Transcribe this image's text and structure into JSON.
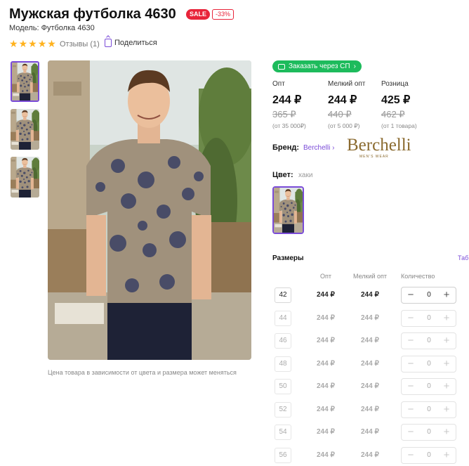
{
  "product": {
    "title": "Мужская футболка 4630",
    "sale_badge": "SALE",
    "discount_badge": "-33%",
    "model": "Модель: Футболка 4630",
    "rating": 5,
    "reviews": "Отзывы (1)",
    "share": "Поделиться",
    "price_note": "Цена товара в зависимости от цвета и размера может меняться"
  },
  "joint_purchase": {
    "label": "Заказать через СП",
    "arrow": "›"
  },
  "prices": [
    {
      "label": "Опт",
      "now": "244 ₽",
      "old": "365 ₽",
      "condition": "(от 35 000₽)"
    },
    {
      "label": "Мелкий опт",
      "now": "244 ₽",
      "old": "440 ₽",
      "condition": "(от 5 000 ₽)"
    },
    {
      "label": "Розница",
      "now": "425 ₽",
      "old": "462 ₽",
      "condition": "(от 1 товара)"
    }
  ],
  "brand": {
    "label": "Бренд:",
    "name": "Berchelli",
    "arrow": "›",
    "logo": "Berchelli",
    "logo_sub": "MEN'S WEAR"
  },
  "color": {
    "label": "Цвет:",
    "value": "хаки"
  },
  "sizes": {
    "title": "Размеры",
    "table_link": "Таб",
    "headers": {
      "opt": "Опт",
      "small": "Мелкий опт",
      "qty": "Количество"
    },
    "rows": [
      {
        "size": "42",
        "opt": "244 ₽",
        "small": "244 ₽",
        "qty": "0",
        "available": true
      },
      {
        "size": "44",
        "opt": "244 ₽",
        "small": "244 ₽",
        "qty": "0",
        "available": false
      },
      {
        "size": "46",
        "opt": "244 ₽",
        "small": "244 ₽",
        "qty": "0",
        "available": false
      },
      {
        "size": "48",
        "opt": "244 ₽",
        "small": "244 ₽",
        "qty": "0",
        "available": false
      },
      {
        "size": "50",
        "opt": "244 ₽",
        "small": "244 ₽",
        "qty": "0",
        "available": false
      },
      {
        "size": "52",
        "opt": "244 ₽",
        "small": "244 ₽",
        "qty": "0",
        "available": false
      },
      {
        "size": "54",
        "opt": "244 ₽",
        "small": "244 ₽",
        "qty": "0",
        "available": false
      },
      {
        "size": "56",
        "opt": "244 ₽",
        "small": "244 ₽",
        "qty": "0",
        "available": false
      }
    ]
  },
  "colors": {
    "accent": "#7a4bd8",
    "sale": "#e8243a",
    "sp_green": "#1dbb5c",
    "star": "#ffb21e"
  }
}
